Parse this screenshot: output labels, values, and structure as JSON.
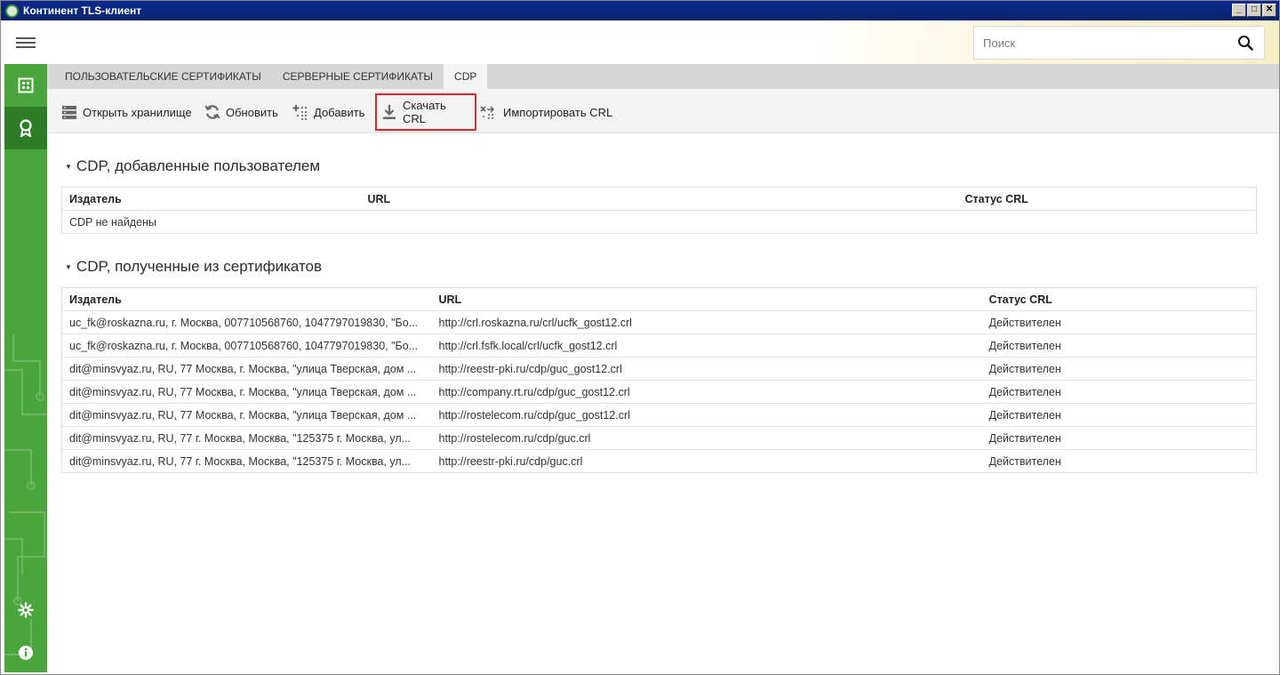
{
  "window": {
    "title": "Континент TLS-клиент",
    "controls": [
      "_",
      "□",
      "✕"
    ]
  },
  "header": {
    "search": {
      "placeholder": "Поиск",
      "value": ""
    }
  },
  "sidebar": {
    "items": [
      {
        "icon": "dashboard-icon"
      },
      {
        "icon": "certificate-icon",
        "active": true
      },
      {
        "icon": "gear-icon"
      },
      {
        "icon": "info-icon"
      }
    ]
  },
  "tabs": [
    {
      "label": "ПОЛЬЗОВАТЕЛЬСКИЕ СЕРТИФИКАТЫ",
      "active": false
    },
    {
      "label": "СЕРВЕРНЫЕ СЕРТИФИКАТЫ",
      "active": false
    },
    {
      "label": "CDP",
      "active": true
    }
  ],
  "toolbar": {
    "open_storage": "Открыть хранилище",
    "refresh": "Обновить",
    "add": "Добавить",
    "download_crl": "Скачать CRL",
    "import_crl": "Импортировать CRL"
  },
  "user_cdp": {
    "title": "CDP, добавленные пользователем",
    "columns": [
      "Издатель",
      "URL",
      "Статус CRL"
    ],
    "empty": "CDP не найдены"
  },
  "cert_cdp": {
    "title": "CDP, полученные из сертификатов",
    "columns": [
      "Издатель",
      "URL",
      "Статус CRL"
    ],
    "rows": [
      [
        "uc_fk@roskazna.ru, г. Москва, 007710568760, 1047797019830, \"Бо...",
        "http://crl.roskazna.ru/crl/ucfk_gost12.crl",
        "Действителен"
      ],
      [
        "uc_fk@roskazna.ru, г. Москва, 007710568760, 1047797019830, \"Бо...",
        "http://crl.fsfk.local/crl/ucfk_gost12.crl",
        "Действителен"
      ],
      [
        "dit@minsvyaz.ru, RU, 77 Москва, г. Москва, \"улица Тверская, дом ...",
        "http://reestr-pki.ru/cdp/guc_gost12.crl",
        "Действителен"
      ],
      [
        "dit@minsvyaz.ru, RU, 77 Москва, г. Москва, \"улица Тверская, дом ...",
        "http://company.rt.ru/cdp/guc_gost12.crl",
        "Действителен"
      ],
      [
        "dit@minsvyaz.ru, RU, 77 Москва, г. Москва, \"улица Тверская, дом ...",
        "http://rostelecom.ru/cdp/guc_gost12.crl",
        "Действителен"
      ],
      [
        "dit@minsvyaz.ru, RU, 77 г. Москва, Москва, \"125375 г. Москва, ул...",
        "http://rostelecom.ru/cdp/guc.crl",
        "Действителен"
      ],
      [
        "dit@minsvyaz.ru, RU, 77 г. Москва, Москва, \"125375 г. Москва, ул...",
        "http://reestr-pki.ru/cdp/guc.crl",
        "Действителен"
      ]
    ]
  },
  "colors": {
    "sidebar": "#4aa63b",
    "sidebar_active": "#2f7c27",
    "highlight": "#d9232e",
    "titlebar": "#0a246a"
  }
}
